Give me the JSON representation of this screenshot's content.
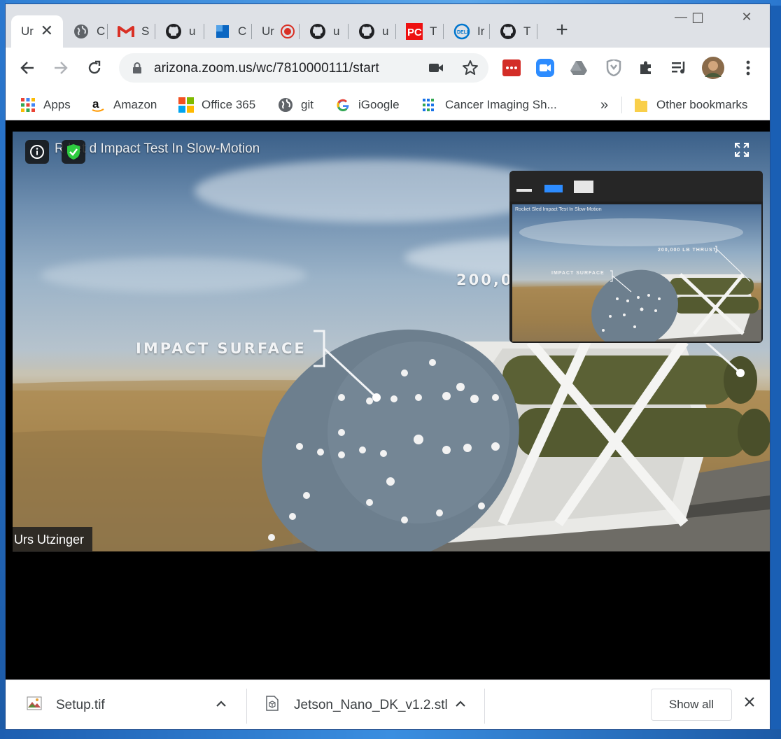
{
  "tabs": [
    {
      "label": "Ur",
      "icon": "zoom-favicon",
      "active": true
    },
    {
      "label": "C",
      "icon": "globe-icon"
    },
    {
      "label": "S",
      "icon": "gmail-icon"
    },
    {
      "label": "u",
      "icon": "github-icon"
    },
    {
      "label": "C",
      "icon": "blue-square-icon"
    },
    {
      "label": "Ur",
      "icon": "record-icon"
    },
    {
      "label": "u",
      "icon": "github-icon"
    },
    {
      "label": "u",
      "icon": "github-icon"
    },
    {
      "label": "T",
      "icon": "pcmag-icon"
    },
    {
      "label": "Ir",
      "icon": "dell-icon"
    },
    {
      "label": "T",
      "icon": "github-icon"
    }
  ],
  "window_controls": {
    "minimize": "—",
    "maximize": "☐",
    "close": "✕"
  },
  "new_tab": "+",
  "address": {
    "url": "arizona.zoom.us/wc/7810000111/start"
  },
  "bookmarks": [
    {
      "label": "Apps",
      "icon": "apps-grid-icon"
    },
    {
      "label": "Amazon",
      "icon": "amazon-icon"
    },
    {
      "label": "Office 365",
      "icon": "microsoft-icon"
    },
    {
      "label": "git",
      "icon": "globe-icon"
    },
    {
      "label": "iGoogle",
      "icon": "google-icon"
    },
    {
      "label": "Cancer Imaging Sh...",
      "icon": "grid-dots-icon"
    }
  ],
  "bookmarks_more": "»",
  "other_bookmarks": "Other bookmarks",
  "video": {
    "title": "R   ket   d Impact Test In Slow-Motion",
    "label_impact": "IMPACT SURFACE",
    "label_thrust": "200,00",
    "participant": "Urs Utzinger"
  },
  "pip": {
    "title": "Rocket Sled Impact Test In Slow-Motion",
    "label_thrust": "200,000 LB THRUST",
    "label_impact": "IMPACT SURFACE"
  },
  "downloads": {
    "items": [
      {
        "name": "Setup.tif",
        "icon": "image-file-icon"
      },
      {
        "name": "Jetson_Nano_DK_v1.2.stl",
        "icon": "3d-file-icon"
      }
    ],
    "show_all": "Show all"
  },
  "colors": {
    "accent_blue": "#1a73e8",
    "zoom_blue": "#2d8cff",
    "shield_green": "#2ecc40"
  }
}
